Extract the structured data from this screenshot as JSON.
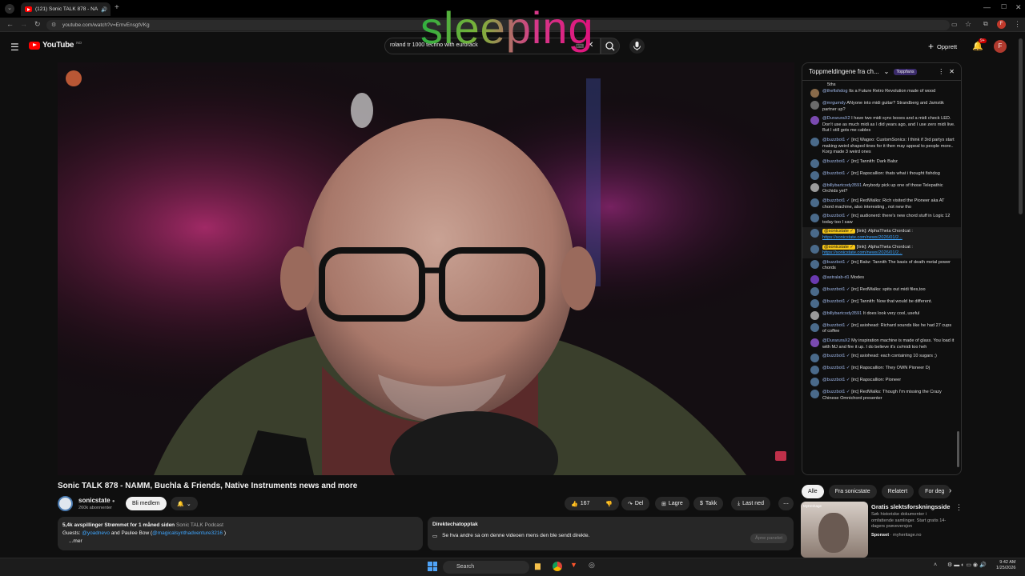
{
  "browser": {
    "tab_title": "(121) Sonic TALK 878 - NA",
    "url": "youtube.com/watch?v=EmvEnsgtVKg"
  },
  "youtube": {
    "logo_text": "YouTube",
    "logo_region": "NO",
    "search_value": "roland tr 1000 techno with eurorack",
    "create_label": "Opprett",
    "notif_count": "9+",
    "avatar_letter": "F"
  },
  "overlay_text": "sleeping",
  "video": {
    "title": "Sonic TALK 878 - NAMM, Buchla & Friends, Native Instruments news and more",
    "channel": "sonicstate",
    "subscribers": "260k abonnenter",
    "join_label": "Bli medlem",
    "likes": "167",
    "share_label": "Del",
    "save_label": "Lagre",
    "thanks_label": "Takk",
    "download_label": "Last ned"
  },
  "description": {
    "stats": "5,4k avspillinger  Strømmet for 1 måned siden",
    "podcast": "Sonic TALK Podcast",
    "guests_prefix": "Guests: ",
    "guest1": "@yoadnevo",
    "guests_mid": " and Paulee Bow (",
    "guest2": "@magicalsynthadventure3216",
    "guests_suffix": " )",
    "more": "...mer"
  },
  "chat_replay": {
    "title": "Direktechatopptak",
    "text": "Se hva andre sa om denne videoen mens den ble sendt direkte.",
    "button": "Åpne panelet"
  },
  "chat": {
    "header": "Toppmeldingene fra ch...",
    "badge": "Toppfans",
    "top_fragment": "5ths",
    "messages": [
      {
        "author": "@thefishdog",
        "text": "Its a Future Retro Revolution made of wood",
        "av": "#8a6b4a"
      },
      {
        "author": "@mrgumdy",
        "text": "ANyone into midi guitar? Strandberg and Jamstik partner up?",
        "av": "#6b6b6b"
      },
      {
        "author": "@DuraruraX2",
        "text": "I have two midi sync boxes and a midi check LED. Don't use as much midi as I did years ago, and I use zero midi live. But I still gots me cables",
        "av": "#7a4ab0"
      },
      {
        "author": "@buzzbot1 ✓",
        "text": "[irc] Wagoo: CustomSonics: I think if 3rd partys start making weird shaped tines for it then may appeal to people more.. Korg made 3 weird ones",
        "av": "#4a6a8a"
      },
      {
        "author": "@buzzbot1 ✓",
        "text": "[irc] Tannith: Dark Babz",
        "av": "#4a6a8a"
      },
      {
        "author": "@buzzbot1 ✓",
        "text": "[irc] Rapscallion: thats what i thought fishdog",
        "av": "#4a6a8a"
      },
      {
        "author": "@billybartcody3591",
        "text": "Anybody pick up one of those Telepathic Orchids yet?",
        "av": "#9a9a9a"
      },
      {
        "author": "@buzzbot1 ✓",
        "text": "[irc] RedWalks: Rich visited the Pioneer aka AT chord machine, also interesting , not new tho",
        "av": "#4a6a8a"
      },
      {
        "author": "@buzzbot1 ✓",
        "text": "[irc] audionerd: there's new chord stuff in Logic 12 today too I saw",
        "av": "#4a6a8a"
      },
      {
        "author": "@sonicstate ✓",
        "text": "[link]: AlphaTheta Chordcat : ",
        "link": "https://sonicstate.com/news/2026/01/2...",
        "mod": true,
        "av": "#4a6a8a"
      },
      {
        "author": "@sonicstate ✓",
        "text": "[link]: AlphaTheta Chordcat : ",
        "link": "https://sonicstate.com/news/2026/01/2...",
        "mod": true,
        "av": "#4a6a8a"
      },
      {
        "author": "@buzzbot1 ✓",
        "text": "[irc] Babz: Tannith The basis of death metal power chords",
        "av": "#4a6a8a"
      },
      {
        "author": "@astralab-d1",
        "text": "Modes",
        "av": "#6a3ab0"
      },
      {
        "author": "@buzzbot1 ✓",
        "text": "[irc] RedWalks: spits out midi files,too",
        "av": "#4a6a8a"
      },
      {
        "author": "@buzzbot1 ✓",
        "text": "[irc] Tannith: Now that would be different.",
        "av": "#4a6a8a"
      },
      {
        "author": "@billybartcody3591",
        "text": "It does look very cool, useful",
        "av": "#9a9a9a"
      },
      {
        "author": "@buzzbot1 ✓",
        "text": "[irc] asiohead: Richard sounds like he had 27 cups of coffee",
        "av": "#4a6a8a"
      },
      {
        "author": "@DuraruraX2",
        "text": "My inspiration machine is made of glass. You load it with MJ and fire it up. I do believe it's cv/midi too heh",
        "av": "#7a4ab0"
      },
      {
        "author": "@buzzbot1 ✓",
        "text": "[irc] asiohead: each containing 10 sugars ;)",
        "av": "#4a6a8a"
      },
      {
        "author": "@buzzbot1 ✓",
        "text": "[irc] Rapscallion: They OWN Pioneer Dj",
        "av": "#4a6a8a"
      },
      {
        "author": "@buzzbot1 ✓",
        "text": "[irc] Rapscallion: Pioneer",
        "av": "#4a6a8a"
      },
      {
        "author": "@buzzbot1 ✓",
        "text": "[irc] RedWalks: Though I'm missing the Crazy Chinese Omnichord presenter",
        "av": "#4a6a8a"
      }
    ]
  },
  "filters": [
    "Alle",
    "Fra sonicstate",
    "Relatert",
    "For deg"
  ],
  "ad": {
    "brand": "MyHeritage",
    "title": "Gratis slektsforskningsside",
    "body": "Søk historiske dokumenter i omfattende samlinger. Start gratis 14-dagers prøveversjon",
    "sponsored": "Sponset",
    "domain": "· myheritage.no"
  },
  "taskbar": {
    "search": "Search",
    "time": "9:42 AM",
    "date": "1/25/2026"
  },
  "colors": {
    "accent_red": "#ff0000",
    "link": "#3ea6ff",
    "mod_badge": "#f5c518"
  }
}
